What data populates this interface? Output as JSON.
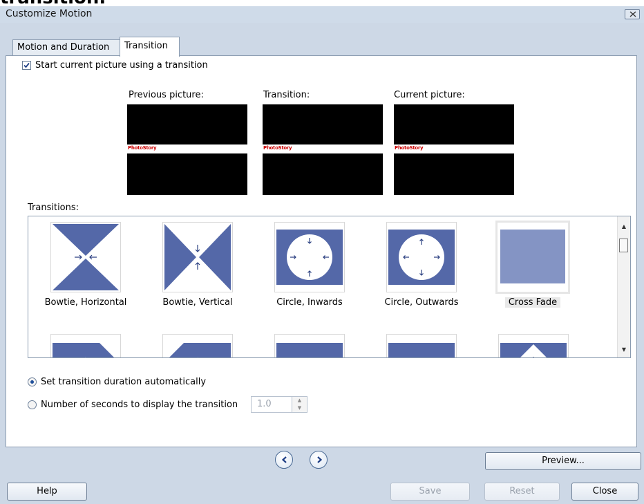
{
  "page_caption_cropped": "transition.",
  "window": {
    "title": "Customize Motion"
  },
  "tabs": [
    {
      "label": "Motion and Duration",
      "active": false
    },
    {
      "label": "Transition",
      "active": true
    }
  ],
  "start_transition": {
    "label": "Start current picture using a transition",
    "checked": true
  },
  "previews": {
    "previous_label": "Previous picture:",
    "transition_label": "Transition:",
    "current_label": "Current picture:",
    "watermark_text": "PhotoStory"
  },
  "transitions": {
    "label": "Transitions:",
    "items": [
      {
        "name": "Bowtie, Horizontal",
        "selected": false
      },
      {
        "name": "Bowtie, Vertical",
        "selected": false
      },
      {
        "name": "Circle, Inwards",
        "selected": false
      },
      {
        "name": "Circle, Outwards",
        "selected": false
      },
      {
        "name": "Cross Fade",
        "selected": true
      }
    ]
  },
  "duration": {
    "auto_label": "Set transition duration automatically",
    "manual_label": "Number of seconds to display the transition",
    "selected": "auto",
    "seconds_value": "1.0"
  },
  "buttons": {
    "preview": "Preview...",
    "help": "Help",
    "save": "Save",
    "reset": "Reset",
    "close": "Close"
  },
  "colors": {
    "transition_blue": "#5468a8",
    "crossfade_blue": "#8494c4",
    "window_bg": "#cdd8e6"
  },
  "icons": [
    "close-icon",
    "checkmark-icon",
    "previous-arrow-icon",
    "next-arrow-icon",
    "scroll-up-icon",
    "scroll-down-icon",
    "spin-up-icon",
    "spin-down-icon"
  ]
}
